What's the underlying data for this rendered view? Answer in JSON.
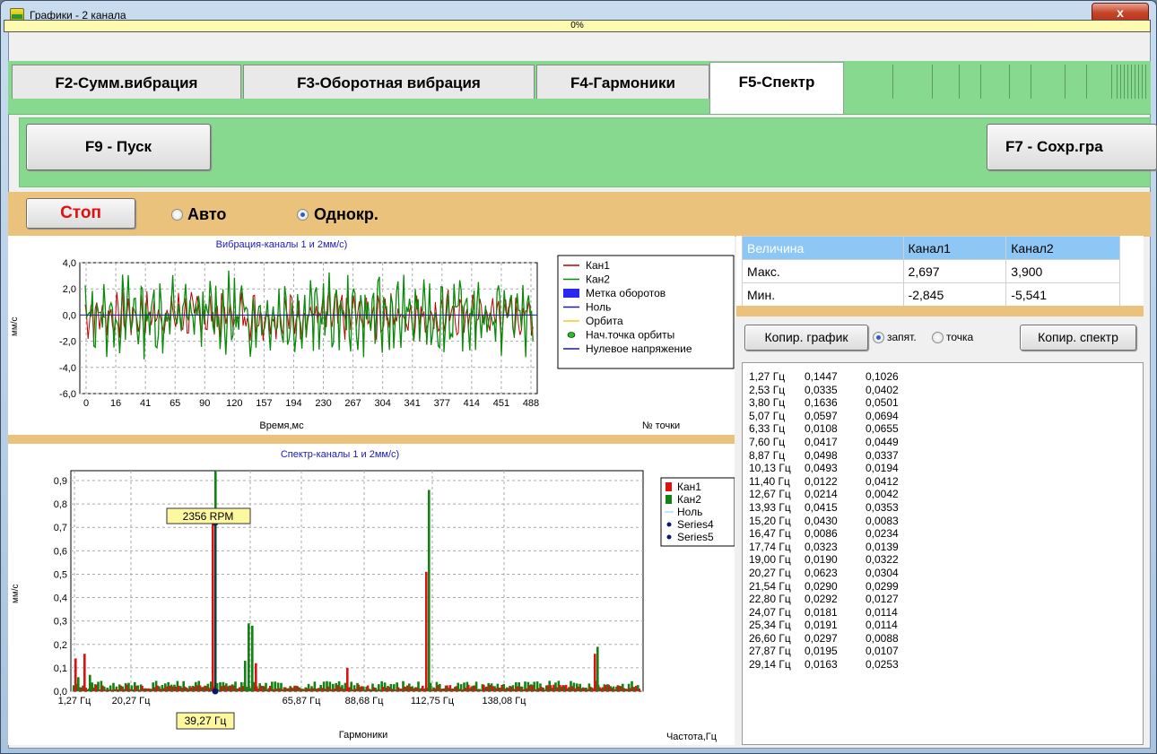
{
  "window": {
    "title": "Графики - 2 канала",
    "close": "x"
  },
  "progress": {
    "label": "0%",
    "value": 0
  },
  "tabs": [
    {
      "label": "F2-Сумм.вибрация",
      "active": false
    },
    {
      "label": "F3-Оборотная вибрация",
      "active": false
    },
    {
      "label": "F4-Гармоники",
      "active": false
    },
    {
      "label": "F5-Спектр",
      "active": true
    }
  ],
  "toolbar": {
    "start": "F9 - Пуск",
    "save": "F7 - Сохр.гра"
  },
  "controls": {
    "stop": "Стоп",
    "auto": "Авто",
    "single": "Однокр.",
    "auto_checked": false,
    "single_checked": true
  },
  "vibration_chart": {
    "title": "Вибрация-каналы 1 и 2мм/с)",
    "ylabel": "мм/с",
    "xlabel": "Время,мс",
    "corner_label": "№ точки",
    "yticks": [
      "4,0",
      "2,0",
      "0,0",
      "-2,0",
      "-4,0",
      "-6,0"
    ],
    "xticks": [
      "0",
      "16",
      "41",
      "65",
      "90",
      "120",
      "157",
      "194",
      "230",
      "267",
      "304",
      "341",
      "377",
      "414",
      "451",
      "488"
    ],
    "legend": [
      "Кан1",
      "Кан2",
      "Метка оборотов",
      "Ноль",
      "Орбита",
      "Нач.точка орбиты",
      "Нулевое напряжение"
    ],
    "colors": {
      "ch1": "#c00000",
      "ch2": "#0a8a0a",
      "mark": "#2828f0",
      "zero": "#1c1ca0",
      "orbit": "#e8d020",
      "orbit_start": "#20c020"
    }
  },
  "spectrum_chart": {
    "title": "Спектр-каналы 1 и 2мм/с)",
    "ylabel": "мм/с",
    "xlabel": "Гармоники",
    "corner_label": "Частота,Гц",
    "yticks": [
      "0,9",
      "0,8",
      "0,7",
      "0,6",
      "0,5",
      "0,4",
      "0,3",
      "0,2",
      "0,1",
      "0,0"
    ],
    "xticks": [
      "1,27 Гц",
      "20,27 Гц",
      "65,87 Гц",
      "88,68 Гц",
      "112,75 Гц",
      "138,08 Гц"
    ],
    "legend": [
      "Кан1",
      "Кан2",
      "Ноль",
      "Series4",
      "Series5"
    ],
    "rpm_label": "2356 RPM",
    "freq_label": "39,27 Гц",
    "colors": {
      "ch1": "#e01010",
      "ch2": "#128212",
      "zero": "#90c0f0",
      "series": "#0a1a6a"
    }
  },
  "stats_table": {
    "headers": [
      "Величина",
      "Канал1",
      "Канал2"
    ],
    "rows": [
      [
        "Макс.",
        "2,697",
        "3,900"
      ],
      [
        "Мин.",
        "-2,845",
        "-5,541"
      ]
    ]
  },
  "copy_controls": {
    "copy_chart": "Копир. график",
    "comma": "запят.",
    "dot": "точка",
    "copy_spectrum": "Копир. спектр",
    "comma_checked": true
  },
  "spectrum_list": [
    [
      "1,27 Гц",
      "0,1447",
      "0,1026"
    ],
    [
      "2,53 Гц",
      "0,0335",
      "0,0402"
    ],
    [
      "3,80 Гц",
      "0,1636",
      "0,0501"
    ],
    [
      "5,07 Гц",
      "0,0597",
      "0,0694"
    ],
    [
      "6,33 Гц",
      "0,0108",
      "0,0655"
    ],
    [
      "7,60 Гц",
      "0,0417",
      "0,0449"
    ],
    [
      "8,87 Гц",
      "0,0498",
      "0,0337"
    ],
    [
      "10,13 Гц",
      "0,0493",
      "0,0194"
    ],
    [
      "11,40 Гц",
      "0,0122",
      "0,0412"
    ],
    [
      "12,67 Гц",
      "0,0214",
      "0,0042"
    ],
    [
      "13,93 Гц",
      "0,0415",
      "0,0353"
    ],
    [
      "15,20 Гц",
      "0,0430",
      "0,0083"
    ],
    [
      "16,47 Гц",
      "0,0086",
      "0,0234"
    ],
    [
      "17,74 Гц",
      "0,0323",
      "0,0139"
    ],
    [
      "19,00 Гц",
      "0,0190",
      "0,0322"
    ],
    [
      "20,27 Гц",
      "0,0623",
      "0,0304"
    ],
    [
      "21,54 Гц",
      "0,0290",
      "0,0299"
    ],
    [
      "22,80 Гц",
      "0,0292",
      "0,0127"
    ],
    [
      "24,07 Гц",
      "0,0181",
      "0,0114"
    ],
    [
      "25,34 Гц",
      "0,0191",
      "0,0114"
    ],
    [
      "26,60 Гц",
      "0,0297",
      "0,0088"
    ],
    [
      "27,87 Гц",
      "0,0195",
      "0,0107"
    ],
    [
      "29,14 Гц",
      "0,0163",
      "0,0253"
    ]
  ]
}
